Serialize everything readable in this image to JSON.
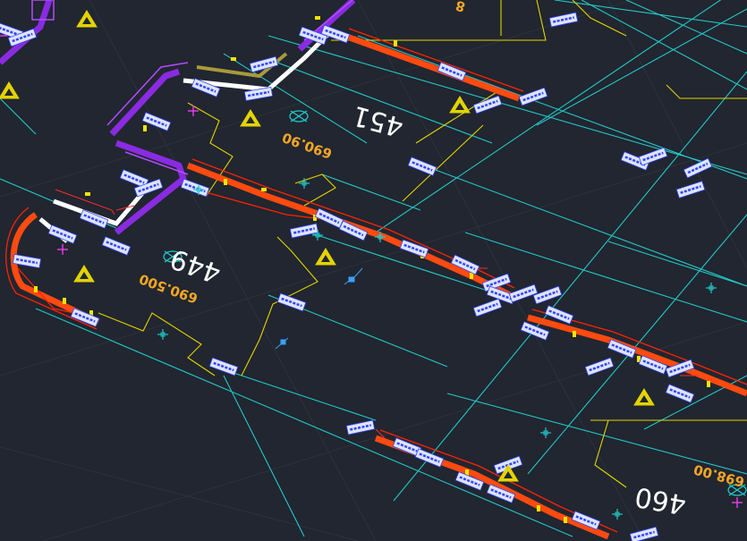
{
  "colors": {
    "background": "#212630",
    "cyan": "#23c7c7",
    "yellow": "#e3d400",
    "orange_red": "#ff4a10",
    "purple": "#8a2be2",
    "white": "#ffffff",
    "label_blue": "#2f45ff",
    "label_bg": "#dfe4ff",
    "elevation_orange": "#f5a623",
    "grid": "#2c323d"
  },
  "lots": [
    {
      "number": "451",
      "elevation": "690.90"
    },
    {
      "number": "449",
      "elevation": "690.500"
    },
    {
      "number": "460",
      "elevation": "698.00"
    }
  ],
  "partial_labels": [
    {
      "text": "8"
    }
  ]
}
